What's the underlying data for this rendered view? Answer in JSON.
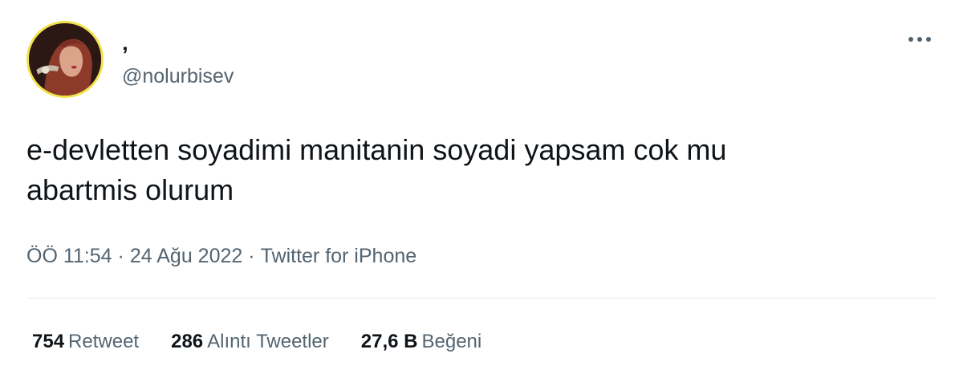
{
  "tweet": {
    "author": {
      "display_name": "‚",
      "handle": "@nolurbisev",
      "avatar_icon": "profile-photo",
      "avatar_ring_color": "#f2e24a"
    },
    "more_icon": "more-options-icon",
    "text": "e-devletten soyadimi manitanin soyadi yapsam cok mu\nabartmis olurum",
    "meta": {
      "time": "ÖÖ 11:54",
      "separator": "·",
      "date": "24 Ağu 2022",
      "source": "Twitter for iPhone"
    },
    "stats": {
      "retweets": {
        "count": "754",
        "label": "Retweet"
      },
      "quotes": {
        "count": "286",
        "label": "Alıntı Tweetler"
      },
      "likes": {
        "count": "27,6 B",
        "label": "Beğeni"
      }
    },
    "colors": {
      "text_primary": "#0f1419",
      "text_secondary": "#536471",
      "divider": "#e6e9eb"
    }
  }
}
